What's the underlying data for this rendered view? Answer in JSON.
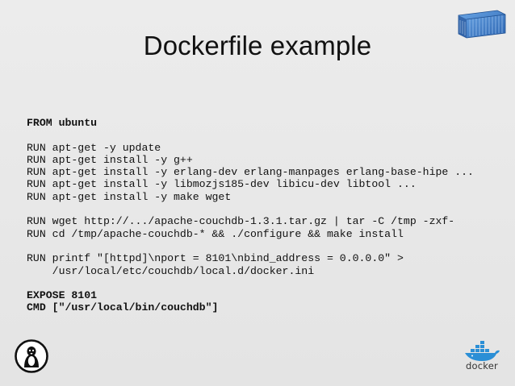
{
  "slide": {
    "title": "Dockerfile example",
    "code_lines": [
      {
        "text": "FROM ubuntu",
        "bold": true
      },
      {
        "text": "",
        "bold": false
      },
      {
        "text": "RUN apt-get -y update",
        "bold": false
      },
      {
        "text": "RUN apt-get install -y g++",
        "bold": false
      },
      {
        "text": "RUN apt-get install -y erlang-dev erlang-manpages erlang-base-hipe ...",
        "bold": false
      },
      {
        "text": "RUN apt-get install -y libmozjs185-dev libicu-dev libtool ...",
        "bold": false
      },
      {
        "text": "RUN apt-get install -y make wget",
        "bold": false
      },
      {
        "text": "",
        "bold": false
      },
      {
        "text": "RUN wget http://.../apache-couchdb-1.3.1.tar.gz | tar -C /tmp -zxf-",
        "bold": false
      },
      {
        "text": "RUN cd /tmp/apache-couchdb-* && ./configure && make install",
        "bold": false
      },
      {
        "text": "",
        "bold": false
      },
      {
        "text": "RUN printf \"[httpd]\\nport = 8101\\nbind_address = 0.0.0.0\" >",
        "bold": false
      },
      {
        "text": "    /usr/local/etc/couchdb/local.d/docker.ini",
        "bold": false
      },
      {
        "text": "",
        "bold": false
      },
      {
        "text": "EXPOSE 8101",
        "bold": true
      },
      {
        "text": "CMD [\"/usr/local/bin/couchdb\"]",
        "bold": true
      }
    ],
    "docker_wordmark": "docker",
    "icons": [
      "shipping-container-icon",
      "tux-penguin-logo",
      "docker-whale-logo"
    ],
    "colors": {
      "background": "#e8e8e8",
      "text": "#111111",
      "container_blue": "#3f7fcf",
      "docker_blue": "#2b8fd6"
    }
  }
}
